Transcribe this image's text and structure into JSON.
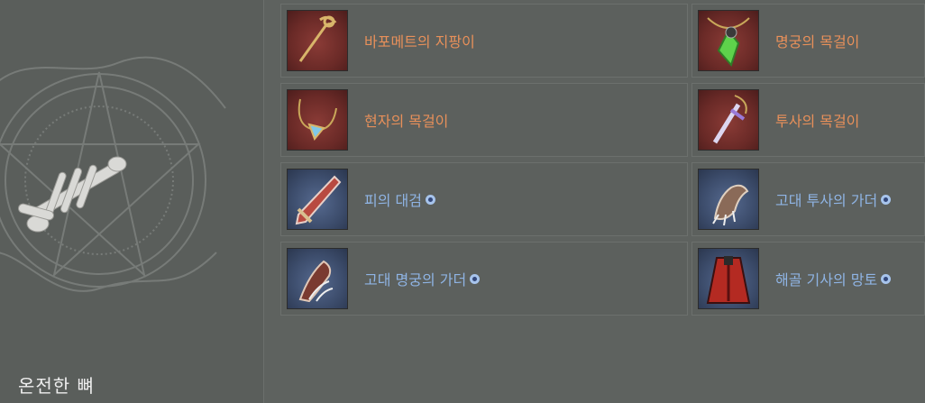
{
  "left": {
    "title": "온전한 뼈"
  },
  "items": [
    {
      "name": "바포메트의 지팡이",
      "color": "orange",
      "bg": "red",
      "icon": "staff-icon",
      "badge": false
    },
    {
      "name": "명궁의 목걸이",
      "color": "orange",
      "bg": "red",
      "icon": "green-gem-necklace-icon",
      "badge": false
    },
    {
      "name": "현자의 목걸이",
      "color": "orange",
      "bg": "red",
      "icon": "pendant-necklace-icon",
      "badge": false
    },
    {
      "name": "투사의 목걸이",
      "color": "orange",
      "bg": "red",
      "icon": "dagger-necklace-icon",
      "badge": false
    },
    {
      "name": "피의 대검",
      "color": "blue",
      "bg": "blue",
      "icon": "greatsword-icon",
      "badge": true
    },
    {
      "name": "고대 투사의 가더",
      "color": "blue",
      "bg": "blue",
      "icon": "claw-gauntlet-icon",
      "badge": true
    },
    {
      "name": "고대 명궁의 가더",
      "color": "blue",
      "bg": "blue",
      "icon": "talon-gauntlet-icon",
      "badge": true
    },
    {
      "name": "해골 기사의 망토",
      "color": "blue",
      "bg": "blue",
      "icon": "red-cloak-icon",
      "badge": true
    }
  ],
  "colors": {
    "orange": "#e8905a",
    "blue": "#8fb4e4"
  }
}
